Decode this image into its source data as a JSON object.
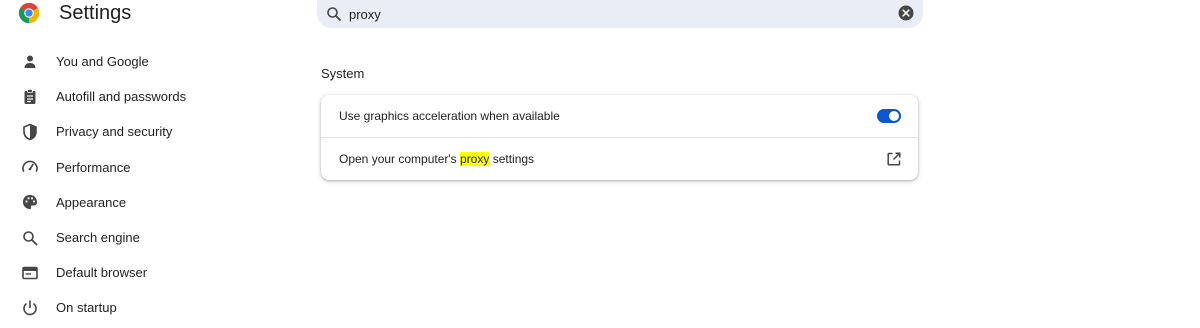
{
  "header": {
    "title": "Settings"
  },
  "search": {
    "value": "proxy",
    "placeholder": "Search settings"
  },
  "sidebar": {
    "items": [
      {
        "label": "You and Google",
        "icon": "person-icon"
      },
      {
        "label": "Autofill and passwords",
        "icon": "clipboard-icon"
      },
      {
        "label": "Privacy and security",
        "icon": "shield-icon"
      },
      {
        "label": "Performance",
        "icon": "speedometer-icon"
      },
      {
        "label": "Appearance",
        "icon": "palette-icon"
      },
      {
        "label": "Search engine",
        "icon": "search-icon"
      },
      {
        "label": "Default browser",
        "icon": "browser-icon"
      },
      {
        "label": "On startup",
        "icon": "power-icon"
      }
    ]
  },
  "main": {
    "section_title": "System",
    "rows": {
      "graphics": {
        "label": "Use graphics acceleration when available",
        "enabled": true
      },
      "proxy": {
        "label_before": "Open your computer's ",
        "label_highlight": "proxy",
        "label_after": " settings"
      }
    }
  },
  "colors": {
    "accent": "#0b57d0",
    "search_bg": "#e9eef6",
    "highlight": "#ffff00"
  }
}
